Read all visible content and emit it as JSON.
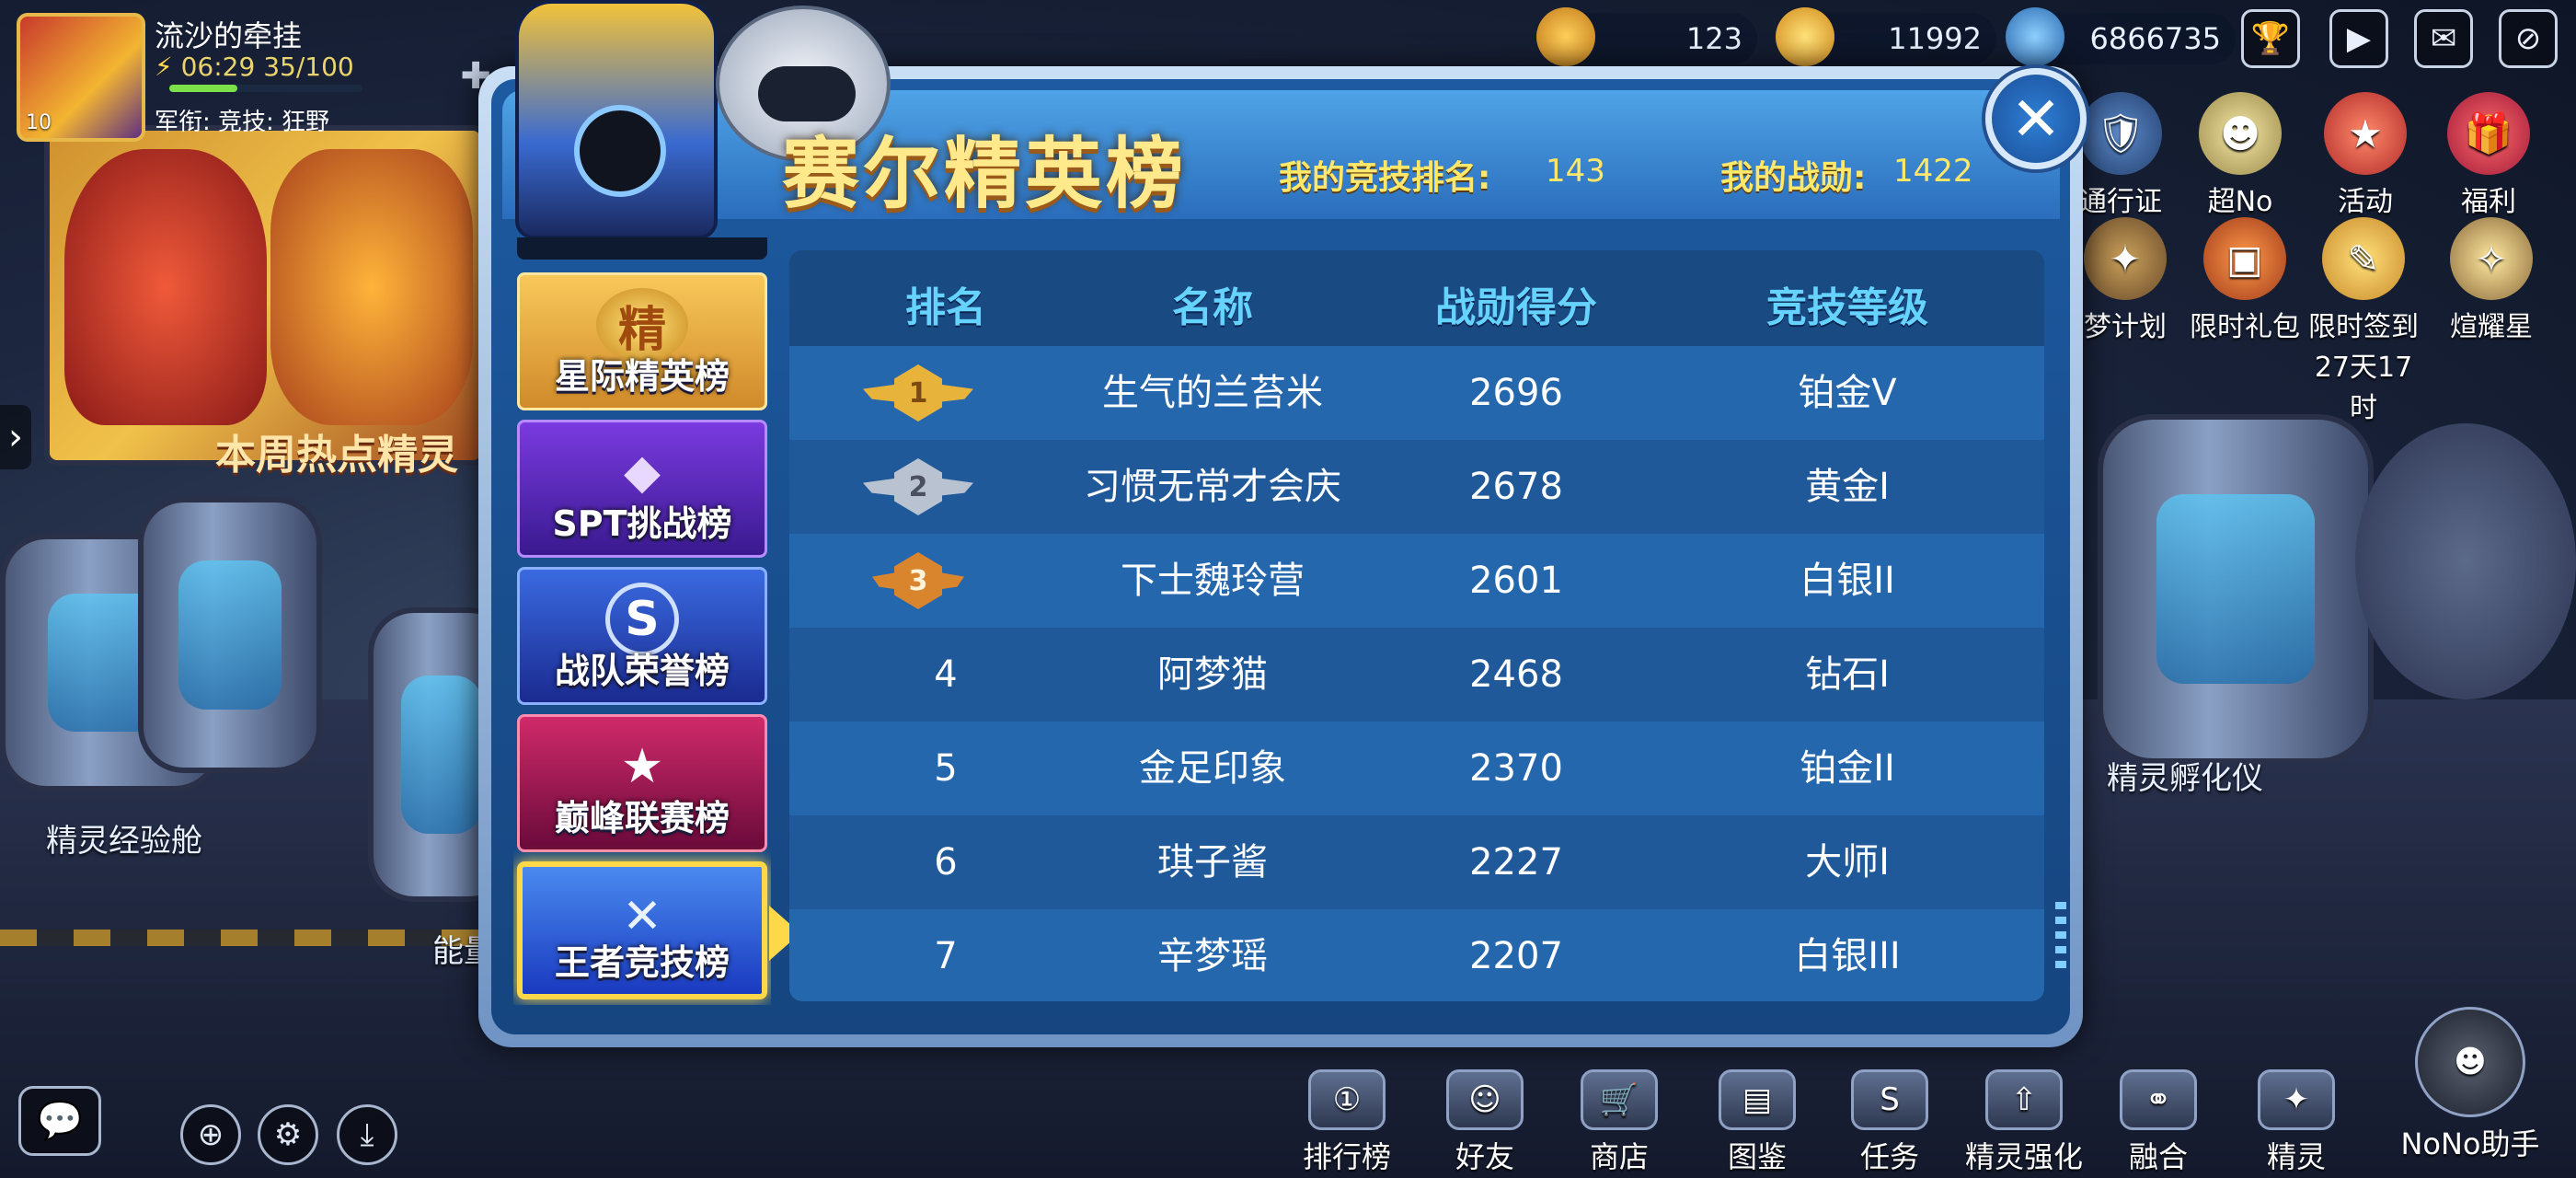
{
  "player": {
    "name": "流沙的牵挂",
    "time": "06:29",
    "energy": "35/100",
    "level_badge": "10",
    "rank_line": "军衔: 竞技: 狂野"
  },
  "resources": [
    {
      "icon": "gem-chest-icon",
      "value": "123"
    },
    {
      "icon": "gold-bar-icon",
      "value": "11992"
    },
    {
      "icon": "coin-ufo-icon",
      "value": "6866735"
    }
  ],
  "top_icons": [
    "trophy-icon",
    "play-icon",
    "mail-icon",
    "eye-slash-icon"
  ],
  "features": [
    {
      "label": "通行证",
      "icon": "pass-badge-icon"
    },
    {
      "label": "超No",
      "icon": "nono-icon"
    },
    {
      "label": "活动",
      "icon": "activity-star-icon"
    },
    {
      "label": "福利",
      "icon": "gift-box-icon"
    },
    {
      "label": "梦计划",
      "icon": "dream-plan-icon"
    },
    {
      "label": "限时礼包",
      "icon": "limited-pack-icon"
    },
    {
      "label": "限时签到",
      "sub": "27天17时",
      "icon": "signin-icon"
    },
    {
      "label": "煊耀星",
      "icon": "blaze-star-icon"
    }
  ],
  "scene": {
    "hot_banner": "本周热点精灵",
    "exp_cabin": "精灵经验舱",
    "incubator": "精灵孵化仪",
    "energy_partial": "能量"
  },
  "modal": {
    "title": "赛尔精英榜",
    "my_rank_label": "我的竞技排名:",
    "my_rank_value": "143",
    "my_merit_label": "我的战勋:",
    "my_merit_value": "1422",
    "close": "✕"
  },
  "tabs": [
    {
      "label": "星际精英榜",
      "emblem": "精"
    },
    {
      "label": "SPT挑战榜",
      "emblem": "◆"
    },
    {
      "label": "战队荣誉榜",
      "emblem": "S"
    },
    {
      "label": "巅峰联赛榜",
      "emblem": "★"
    },
    {
      "label": "王者竞技榜",
      "emblem": "✕"
    }
  ],
  "table": {
    "headers": [
      "排名",
      "名称",
      "战勋得分",
      "竞技等级"
    ],
    "rows": [
      {
        "rank": "1",
        "name": "生气的兰苔米",
        "score": "2696",
        "grade": "铂金V"
      },
      {
        "rank": "2",
        "name": "习惯无常才会庆幸",
        "score": "2678",
        "grade": "黄金I"
      },
      {
        "rank": "3",
        "name": "下士魏玲营",
        "score": "2601",
        "grade": "白银II"
      },
      {
        "rank": "4",
        "name": "阿梦猫",
        "score": "2468",
        "grade": "钻石I"
      },
      {
        "rank": "5",
        "name": "金足印象",
        "score": "2370",
        "grade": "铂金II"
      },
      {
        "rank": "6",
        "name": "琪子酱",
        "score": "2227",
        "grade": "大师I"
      },
      {
        "rank": "7",
        "name": "辛梦瑶",
        "score": "2207",
        "grade": "白银III"
      }
    ]
  },
  "bottom_nav": [
    {
      "label": "排行榜",
      "icon": "ranking-icon"
    },
    {
      "label": "好友",
      "icon": "friends-icon"
    },
    {
      "label": "商店",
      "icon": "shop-cart-icon"
    },
    {
      "label": "图鉴",
      "icon": "codex-icon"
    },
    {
      "label": "任务",
      "icon": "task-icon"
    },
    {
      "label": "精灵强化",
      "icon": "enhance-icon"
    },
    {
      "label": "融合",
      "icon": "fusion-icon"
    },
    {
      "label": "精灵",
      "icon": "spirit-icon"
    },
    {
      "label": "NoNo助手",
      "icon": "nono-assistant-icon"
    }
  ],
  "colors": {
    "header_text": "#66d3ff",
    "stat_text": "#ffe76a",
    "active_tab_border": "#ffd84a",
    "gold_medal": "#e8b33a",
    "silver_medal": "#b8c2d0",
    "bronze_medal": "#d9852e"
  }
}
